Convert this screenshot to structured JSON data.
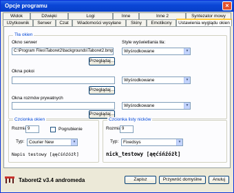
{
  "window": {
    "title": "Opcje programu",
    "close_label": "×"
  },
  "tabs": {
    "row1": [
      "Widok",
      "Dźwięki",
      "Logi",
      "Inne",
      "Inne 2",
      "Syntezator mowy"
    ],
    "row2": [
      "Użytkownik",
      "Serwer",
      "Czat",
      "Wiadomości wysyłane",
      "Skiny",
      "Emotikony",
      "Ustawienia wyglądu okien"
    ]
  },
  "background": {
    "group_title": "Tła okien",
    "server_window_label": "Okno serwer",
    "server_window_path": "C:\\Program Files\\Taboret2\\backgrounds\\Taboret2.bmp",
    "rooms_window_label": "Okna pokoi",
    "rooms_window_path": "",
    "private_window_label": "Okna rozmów prywatnych",
    "private_window_path": "",
    "browse_label": "Przeglądaj...",
    "style_label": "Style wyświetlania tła:",
    "style_server": "Wyśrodkowane",
    "style_rooms": "Wyśrodkowane",
    "style_private": "Wyśrodkowane"
  },
  "window_font": {
    "group_title": "Czcionka okien",
    "size_label": "Rozmiar:",
    "size_value": "9",
    "bold_label": "Pogrubienie",
    "type_label": "Typ:",
    "type_value": "Courier New",
    "preview": "Napis testowy [ąęćśńźóżł]"
  },
  "nick_font": {
    "group_title": "Czcionka listy nicków",
    "size_label": "Rozmiar:",
    "size_value": "9",
    "type_label": "Typ:",
    "type_value": "Fixedsys",
    "preview": "nick_testowy [ąęćśńźóżł]"
  },
  "footer": {
    "version": "Taboret2 v3.4 andromeda",
    "save_label": "Zapisz",
    "defaults_label": "Przywróć domyślne",
    "cancel_label": "Anuluj"
  }
}
